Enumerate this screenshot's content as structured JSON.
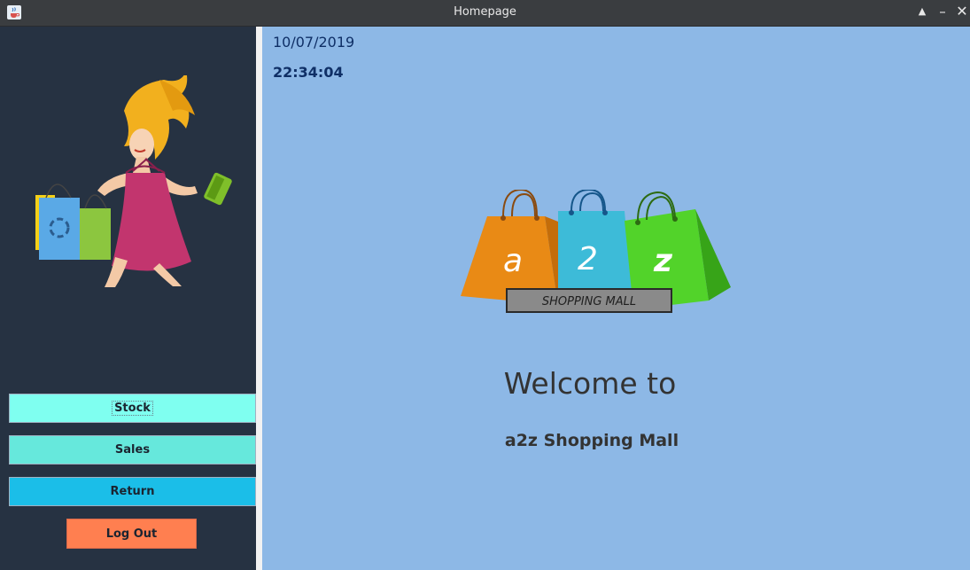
{
  "window": {
    "title": "Homepage",
    "icons": {
      "app": "java-coffee-icon",
      "maximize": "triangle-up-icon",
      "minimize": "minimize-icon",
      "close": "close-icon"
    },
    "maximize_glyph": "▲",
    "minimize_glyph": "–",
    "close_glyph": "✕"
  },
  "sidebar": {
    "illustration": "shopper-woman-with-bags",
    "buttons": {
      "stock": "Stock",
      "sales": "Sales",
      "return": "Return",
      "logout": "Log Out"
    },
    "colors": {
      "background": "#263242",
      "stock": "#7ffff0",
      "sales": "#66e8dc",
      "return": "#1bbee8",
      "logout": "#ff7f50"
    }
  },
  "main": {
    "date": "10/07/2019",
    "time": "22:34:04",
    "logo": {
      "letters": [
        "a",
        "2",
        "z"
      ],
      "banner": "SHOPPING MALL"
    },
    "welcome": "Welcome to",
    "mall_name": "a2z Shopping Mall",
    "background": "#8db8e6"
  }
}
